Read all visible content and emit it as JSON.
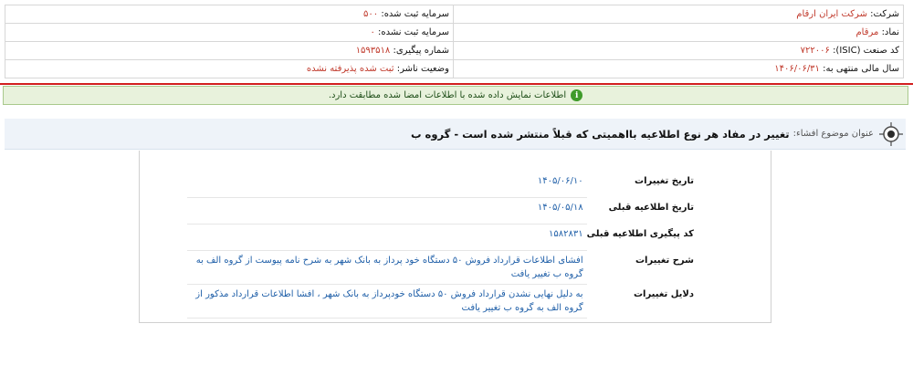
{
  "header": {
    "company_label": "شرکت:",
    "company_value": "شرکت ایران ارقام",
    "symbol_label": "نماد:",
    "symbol_value": "مرقام",
    "isic_label": "کد صنعت (ISIC):",
    "isic_value": "۷۲۲۰۰۶",
    "fiscal_label": "سال مالی منتهی به:",
    "fiscal_value": "۱۴۰۶/۰۶/۳۱",
    "reg_capital_label": "سرمایه ثبت شده:",
    "reg_capital_value": "۵۰۰",
    "unreg_capital_label": "سرمایه ثبت نشده:",
    "unreg_capital_value": "۰",
    "tracking_label": "شماره پیگیری:",
    "tracking_value": "۱۵۹۳۵۱۸",
    "status_label": "وضعیت ناشر:",
    "status_value": "ثبت شده پذیرفته نشده"
  },
  "notice": {
    "text": "اطلاعات نمایش داده شده با اطلاعات امضا شده مطابقت دارد."
  },
  "subject": {
    "label": "عنوان موضوع افشاء:",
    "title": "تغییر در مفاد هر نوع اطلاعیه بااهمیتی که قبلاً منتشر شده است - گروه ب"
  },
  "details": [
    {
      "label": "تاریخ تغییرات",
      "value": "۱۴۰۵/۰۶/۱۰"
    },
    {
      "label": "تاریخ اطلاعیه قبلی",
      "value": "۱۴۰۵/۰۵/۱۸"
    },
    {
      "label": "کد پیگیری اطلاعیه قبلی",
      "value": "۱۵۸۲۸۳۱"
    },
    {
      "label": "شرح تغییرات",
      "value": "افشای اطلاعات قرارداد فروش ۵۰ دستگاه خود پرداز به بانک شهر به شرح نامه پیوست از گروه الف به گروه ب تغییر یافت"
    },
    {
      "label": "دلایل تغییرات",
      "value": "به دلیل نهایی نشدن قرارداد فروش ۵۰ دستگاه خودپرداز به بانک شهر ، افشا اطلاعات قرارداد مذکور از گروه الف به گروه ب تغییر یافت"
    }
  ],
  "colors": {
    "separator": "#d21f1f",
    "notice_bg": "#e8f2dc",
    "subject_bg": "#eef3f9",
    "value_blue": "#1f5fa8",
    "value_red": "#c0392b"
  }
}
